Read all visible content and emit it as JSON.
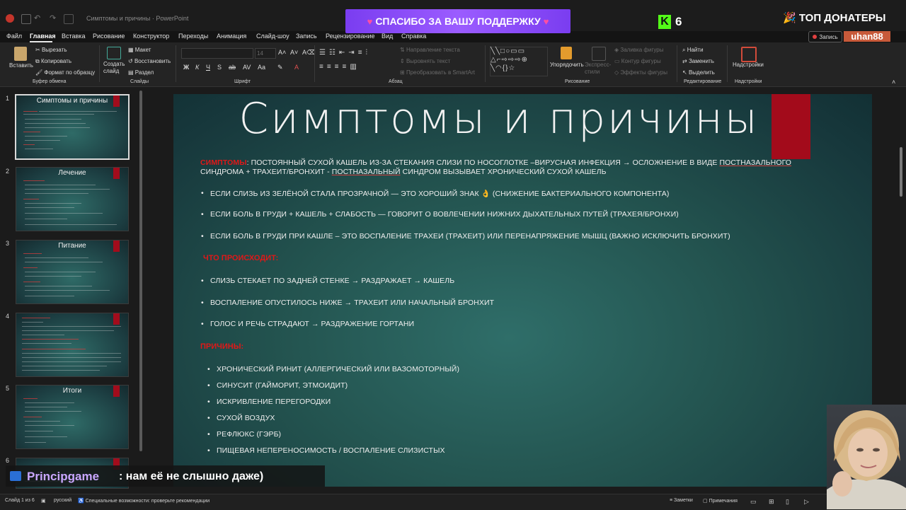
{
  "titlebar": {
    "doc_title": "Симптомы и причины  ·  PowerPoint",
    "banner": "СПАСИБО ЗА ВАШУ ПОДДЕРЖКУ",
    "kick_count": "6",
    "top_donators": "ТОП ДОНАТЕРЫ",
    "user_badge": "uhan88",
    "record_label": "Запись"
  },
  "menu": [
    "Файл",
    "Главная",
    "Вставка",
    "Рисование",
    "Конструктор",
    "Переходы",
    "Анимация",
    "Слайд-шоу",
    "Запись",
    "Рецензирование",
    "Вид",
    "Справка"
  ],
  "ribbon": {
    "paste": "Вставить",
    "cut": "Вырезать",
    "copy": "Копировать",
    "format_painter": "Формат по образцу",
    "clipboard_group": "Буфер обмена",
    "new_slide": "Создать слайд",
    "layout": "Макет",
    "reset": "Восстановить",
    "section": "Раздел",
    "slides_group": "Слайды",
    "font_size": "14",
    "font_group": "Шрифт",
    "text_direction": "Направление текста",
    "align_text": "Выровнять текст",
    "smartart": "Преобразовать в SmartArt",
    "paragraph_group": "Абзац",
    "arrange": "Упорядочить",
    "quick_styles": "Экспресс-стили",
    "shape_fill": "Заливка фигуры",
    "shape_outline": "Контур фигуры",
    "shape_effects": "Эффекты фигуры",
    "drawing_group": "Рисование",
    "find": "Найти",
    "replace": "Заменить",
    "select": "Выделить",
    "editing_group": "Редактирование",
    "addins": "Надстройки",
    "addins_group": "Надстройки"
  },
  "thumbnails": [
    {
      "num": "1",
      "title": "Симптомы и причины"
    },
    {
      "num": "2",
      "title": "Лечение"
    },
    {
      "num": "3",
      "title": "Питание"
    },
    {
      "num": "4",
      "title": ""
    },
    {
      "num": "5",
      "title": "Итоги"
    },
    {
      "num": "6",
      "title": ""
    }
  ],
  "slide": {
    "title": "Симптомы и причины",
    "symptoms_label": "СИМПТОМЫ",
    "symptoms_line1_a": ": ПОСТОЯННЫЙ СУХОЙ КАШЕЛЬ ИЗ-ЗА СТЕКАНИЯ СЛИЗИ ПО НОСОГЛОТКЕ –ВИРУСНАЯ ИНФЕКЦИЯ → ОСЛОЖНЕНИЕ В ВИДЕ ",
    "symptoms_line1_u": "ПОСТНАЗАЛЬНОГО",
    "symptoms_line2_a": "СИНДРОМА + ТРАХЕИТ/БРОНХИТ - ",
    "symptoms_line2_u": "ПОСТНАЗАЛЬНЫЙ",
    "symptoms_line2_b": " СИНДРОМ ВЫЗЫВАЕТ ХРОНИЧЕСКИЙ СУХОЙ КАШЕЛЬ",
    "bullets_a": [
      "ЕСЛИ СЛИЗЬ ИЗ ЗЕЛЁНОЙ СТАЛА ПРОЗРАЧНОЙ — ЭТО ХОРОШИЙ ЗНАК 👌 (СНИЖЕНИЕ БАКТЕРИАЛЬНОГО КОМПОНЕНТА)",
      "ЕСЛИ  БОЛЬ В ГРУДИ + КАШЕЛЬ + СЛАБОСТЬ — ГОВОРИТ О ВОВЛЕЧЕНИИ НИЖНИХ ДЫХАТЕЛЬНЫХ ПУТЕЙ (ТРАХЕЯ/БРОНХИ)",
      "ЕСЛИ БОЛЬ В ГРУДИ ПРИ КАШЛЕ – ЭТО ВОСПАЛЕНИЕ ТРАХЕИ (ТРАХЕИТ) ИЛИ ПЕРЕНАПРЯЖЕНИЕ МЫШЦ (ВАЖНО ИСКЛЮЧИТЬ БРОНХИТ)"
    ],
    "what_happens": "ЧТО ПРОИСХОДИТ:",
    "bullets_b": [
      "СЛИЗЬ СТЕКАЕТ ПО ЗАДНЕЙ СТЕНКЕ → РАЗДРАЖАЕТ → КАШЕЛЬ",
      "ВОСПАЛЕНИЕ ОПУСТИЛОСЬ НИЖЕ → ТРАХЕИТ ИЛИ НАЧАЛЬНЫЙ БРОНХИТ",
      "ГОЛОС И РЕЧЬ СТРАДАЮТ → РАЗДРАЖЕНИЕ ГОРТАНИ"
    ],
    "causes": "ПРИЧИНЫ:",
    "bullets_c": [
      "ХРОНИЧЕСКИЙ РИНИТ (АЛЛЕРГИЧЕСКИЙ ИЛИ ВАЗОМОТОРНЫЙ)",
      "СИНУСИТ (ГАЙМОРИТ, ЭТМОИДИТ)",
      "ИСКРИВЛЕНИЕ ПЕРЕГОРОДКИ",
      "СУХОЙ ВОЗДУХ",
      "РЕФЛЮКС (ГЭРБ)",
      "ПИЩЕВАЯ НЕПЕРЕНОСИМОСТЬ / ВОСПАЛЕНИЕ СЛИЗИСТЫХ"
    ]
  },
  "status": {
    "slide_count": "Слайд 1 из 6",
    "language": "русский",
    "accessibility": "Специальные возможности: проверьте рекомендации",
    "notes": "Заметки",
    "comments": "Примечания"
  },
  "chat": {
    "user": "Principgame",
    "message": ": нам её не слышно даже)"
  }
}
